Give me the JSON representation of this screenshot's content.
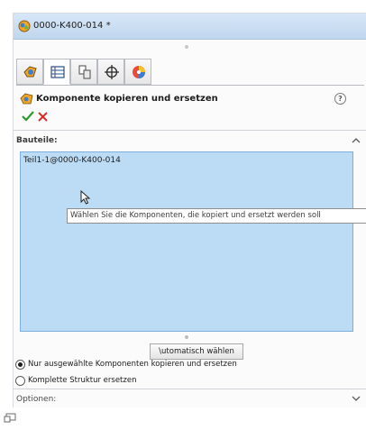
{
  "window": {
    "title": "0000-K400-014 *"
  },
  "tabs": [
    {
      "name": "feature-manager"
    },
    {
      "name": "property-manager"
    },
    {
      "name": "configuration-manager"
    },
    {
      "name": "dimxpert-manager"
    },
    {
      "name": "display-manager"
    }
  ],
  "feature": {
    "title": "Komponente kopieren und ersetzen",
    "help": "?"
  },
  "bauteile": {
    "label": "Bauteile:",
    "items": [
      "Teil1-1@0000-K400-014"
    ]
  },
  "tooltip": {
    "text": "Wählen Sie die Komponenten, die kopiert und ersetzt werden soll"
  },
  "auto_select": {
    "label": "\\utomatisch wählen"
  },
  "radios": [
    {
      "label": "Nur ausgewählte Komponenten kopieren und ersetzen",
      "selected": true
    },
    {
      "label": "Komplette Struktur ersetzen",
      "selected": false
    }
  ],
  "optionen": {
    "label": "Optionen:"
  },
  "colors": {
    "title_bar": "#c0d6ee",
    "selection_fill": "#bcdcf5",
    "selection_border": "#7eaedc",
    "ok_green": "#2c9a2c",
    "cancel_red": "#d62b2b"
  }
}
